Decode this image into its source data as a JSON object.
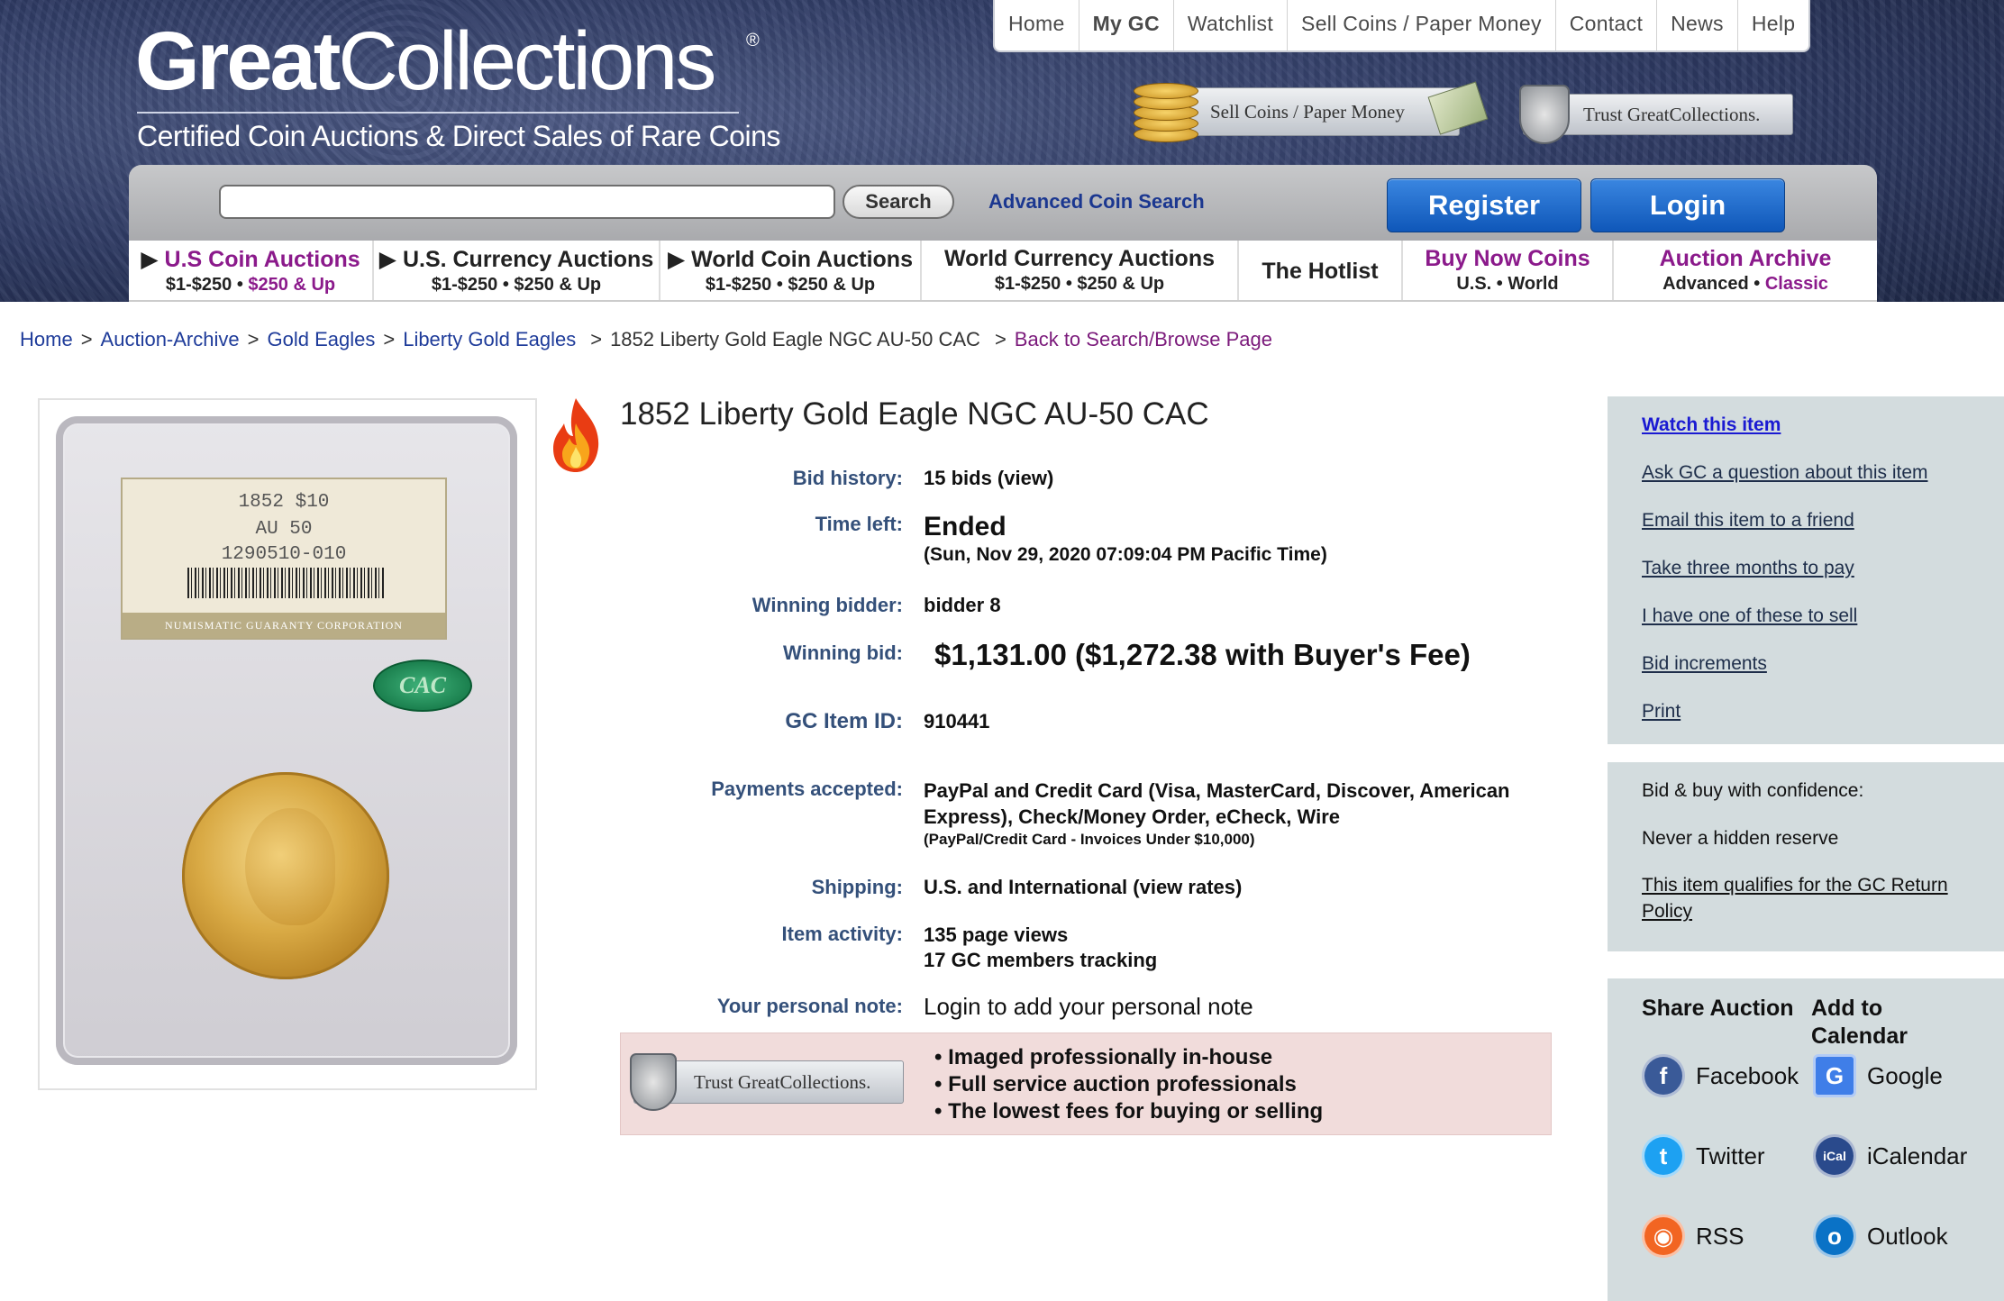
{
  "header": {
    "logo_strong": "Great",
    "logo_light": "Collections",
    "logo_reg": "®",
    "tagline": "Certified Coin Auctions & Direct Sales of Rare Coins",
    "topnav": [
      "Home",
      "My GC",
      "Watchlist",
      "Sell Coins / Paper Money",
      "Contact",
      "News",
      "Help"
    ],
    "promo_sell": "Sell Coins / Paper Money",
    "promo_trust": "Trust GreatCollections."
  },
  "search": {
    "input_value": "",
    "button": "Search",
    "advanced": "Advanced Coin Search",
    "register": "Register",
    "login": "Login"
  },
  "categories": [
    {
      "title": "U.S Coin Auctions",
      "sub1": "$1-$250",
      "sub2": "$250 & Up"
    },
    {
      "title": "U.S. Currency Auctions",
      "sub1": "$1-$250",
      "sub2": "$250 & Up"
    },
    {
      "title": "World Coin Auctions",
      "sub1": "$1-$250",
      "sub2": "$250 & Up"
    },
    {
      "title": "World Currency Auctions",
      "sub1": "$1-$250",
      "sub2": "$250 & Up"
    },
    {
      "title": "The Hotlist"
    },
    {
      "title": "Buy Now Coins",
      "sub1": "U.S.",
      "sub2": "World"
    },
    {
      "title": "Auction Archive",
      "sub1": "Advanced",
      "sub2": "Classic"
    }
  ],
  "breadcrumb": {
    "home": "Home",
    "archive": "Auction-Archive",
    "gold_eagles": "Gold Eagles",
    "liberty": "Liberty Gold Eagles",
    "current": "1852 Liberty Gold Eagle NGC AU-50 CAC",
    "back": "Back to Search/Browse Page",
    "sep": ">"
  },
  "slab": {
    "line1": "1852   $10",
    "line2": "AU 50",
    "line3": "1290510-010",
    "grader": "NUMISMATIC GUARANTY CORPORATION",
    "sticker": "CAC"
  },
  "item": {
    "title": "1852 Liberty Gold Eagle NGC AU-50 CAC",
    "bid_history_label": "Bid history:",
    "bid_history_value": "15 bids (view)",
    "time_left_label": "Time left:",
    "time_left_value": "Ended",
    "time_left_sub": "(Sun, Nov 29, 2020 07:09:04 PM Pacific Time)",
    "winning_bidder_label": "Winning bidder:",
    "winning_bidder_value": "bidder 8",
    "winning_bid_label": "Winning bid:",
    "winning_bid_value": "$1,131.00 ($1,272.38 with Buyer's Fee)",
    "gc_item_id_label": "GC Item ID:",
    "gc_item_id_value": "910441",
    "payments_label": "Payments accepted:",
    "payments_line1": "PayPal and Credit Card (Visa, MasterCard, Discover, American",
    "payments_line2": "Express), Check/Money Order, eCheck, Wire",
    "payments_note": "(PayPal/Credit Card - Invoices Under $10,000)",
    "shipping_label": "Shipping:",
    "shipping_value": "U.S. and International",
    "shipping_link": "(view rates)",
    "activity_label": "Item activity:",
    "activity_views": "135 page views",
    "activity_tracking": "17 GC members tracking",
    "note_label": "Your personal note:",
    "note_link": "Login to add your personal note"
  },
  "trust_box": {
    "badge": "Trust GreatCollections.",
    "bullets": [
      "Imaged professionally in-house",
      "Full service auction professionals",
      "The lowest fees for buying or selling"
    ]
  },
  "sidebar": {
    "actions": [
      "Watch this item",
      "Ask GC a question about this item",
      "Email this item to a friend",
      "Take three months to pay",
      "I have one of these to sell",
      "Bid increments",
      "Print"
    ],
    "confidence_title": "Bid & buy with confidence:",
    "confidence_reserve": "Never a hidden reserve",
    "confidence_return": "This item qualifies for the GC Return Policy",
    "share_title": "Share Auction",
    "calendar_title": "Add to Calendar",
    "share": [
      "Facebook",
      "Twitter",
      "RSS"
    ],
    "calendar": [
      "Google",
      "iCalendar",
      "Outlook"
    ]
  },
  "colors": {
    "header_bg": "#2e3a63",
    "link_blue": "#1f3c9a",
    "visited_purple": "#8b1a8b",
    "label_blue": "#34507a",
    "sidebar_bg": "#d3dcde",
    "trust_bg": "#f1dcdb",
    "button_blue": "#1a67cc"
  },
  "icons": {
    "fire": "fire-icon",
    "facebook": "facebook-icon",
    "twitter": "twitter-icon",
    "rss": "rss-icon",
    "google": "google-calendar-icon",
    "icalendar": "icalendar-icon",
    "outlook": "outlook-icon"
  }
}
